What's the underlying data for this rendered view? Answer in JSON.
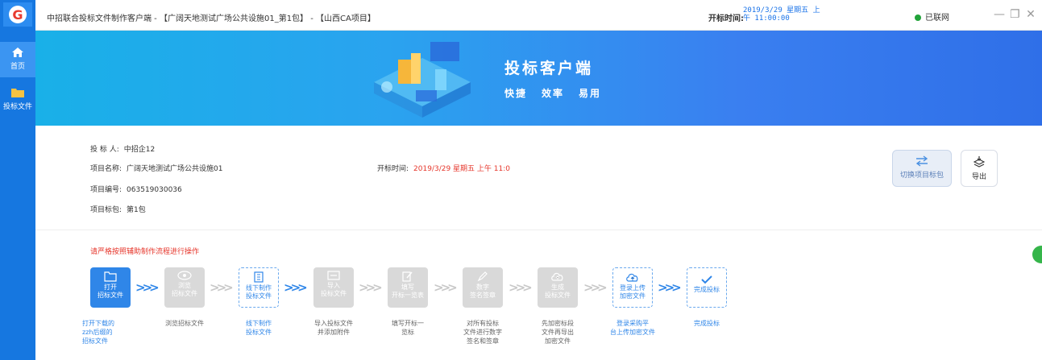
{
  "window": {
    "title": "中招联合投标文件制作客户端 - 【广阔天地测试广场公共设施01_第1包】 - 【山西CA项目】",
    "open_time_label": "开标时间:",
    "open_time_value": "2019/3/29 星期五 上\n午 11:00:00",
    "network_status": "已联网",
    "controls": [
      "—",
      "❐",
      "✕"
    ]
  },
  "sidebar": {
    "logo": "G",
    "items": [
      {
        "label": "首页",
        "icon": "home-icon"
      },
      {
        "label": "投标文件",
        "icon": "folder-icon"
      }
    ]
  },
  "banner": {
    "title": "投标客户端",
    "tags": [
      "快捷",
      "效率",
      "易用"
    ]
  },
  "info": {
    "bidder_label": "投 标 人:",
    "bidder": "中招企12",
    "project_name_label": "项目名称:",
    "project_name": "广阔天地测试广场公共设施01",
    "open_time_label": "开标时间:",
    "open_time": "2019/3/29 星期五 上午 11:0",
    "project_code_label": "项目编号:",
    "project_code": "063519030036",
    "project_package_label": "项目标包:",
    "project_package": "第1包",
    "switch_button": "切换项目标包",
    "export_button": "导出"
  },
  "process": {
    "hint": "请严格按照辅助制作流程进行操作",
    "steps": [
      {
        "label1": "打开",
        "label2": "招标文件",
        "desc": "打开下载的\nzzh后缀的\n招标文件",
        "icon": "folder-open-icon"
      },
      {
        "label1": "浏览",
        "label2": "招标文件",
        "desc": "浏览招标文件",
        "icon": "eye-icon"
      },
      {
        "label1": "线下制作",
        "label2": "投标文件",
        "desc": "线下制作\n投标文件",
        "icon": "document-icon"
      },
      {
        "label1": "导入",
        "label2": "投标文件",
        "desc": "导入投标文件\n并添加附件",
        "icon": "import-icon"
      },
      {
        "label1": "填写",
        "label2": "开标一览表",
        "desc": "填写开标一\n览标",
        "icon": "edit-icon"
      },
      {
        "label1": "数字",
        "label2": "签名签章",
        "desc": "对所有投标\n文件进行数字\n签名和签章",
        "icon": "pen-icon"
      },
      {
        "label1": "生成",
        "label2": "投标文件",
        "desc": "先加密标段\n文件再导出\n加密文件",
        "icon": "cloud-icon"
      },
      {
        "label1": "登录上传",
        "label2": "加密文件",
        "desc": "登录采购平\n台上传加密文件",
        "icon": "upload-icon"
      },
      {
        "label1": "完成投标",
        "label2": "",
        "desc": "完成投标",
        "icon": "check-icon"
      }
    ]
  },
  "colors": {
    "primary": "#2f86e8",
    "warning": "#e6362b",
    "sidebar": "#1677e0"
  }
}
